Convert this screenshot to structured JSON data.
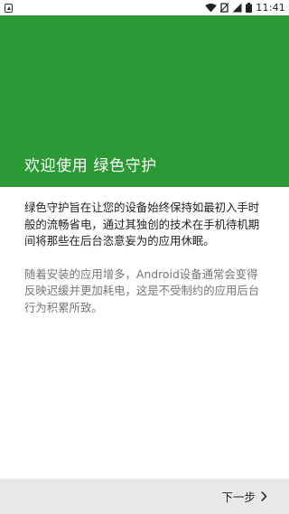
{
  "status_bar": {
    "time": "11:41",
    "icons": [
      "app-notification-icon",
      "wifi-icon",
      "no-sim-icon",
      "signal-icon",
      "battery-icon"
    ]
  },
  "header": {
    "title": "欢迎使用 绿色守护",
    "background_color": "#2b9a36"
  },
  "body": {
    "paragraph_main": "绿色守护旨在让您的设备始终保持如最初入手时般的流畅省电，通过其独创的技术在手机待机期间将那些在后台恣意妄为的应用休眠。",
    "paragraph_secondary": "随着安装的应用增多，Android设备通常会变得反映迟缓并更加耗电，这是不受制约的应用后台行为积累所致。"
  },
  "footer": {
    "next_label": "下一步",
    "next_icon": "chevron-right-icon"
  }
}
